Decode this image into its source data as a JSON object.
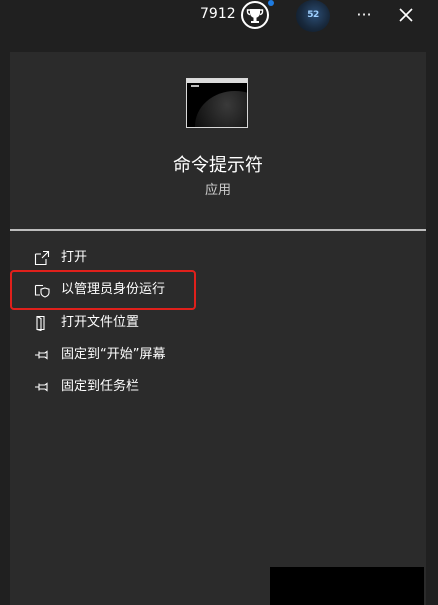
{
  "topbar": {
    "points": "7912",
    "avatar_text": "52",
    "more_label": "···"
  },
  "app": {
    "name": "命令提示符",
    "type": "应用"
  },
  "menu": {
    "items": [
      {
        "label": "打开",
        "icon": "open-icon"
      },
      {
        "label": "以管理员身份运行",
        "icon": "shield-icon",
        "highlighted": true
      },
      {
        "label": "打开文件位置",
        "icon": "file-location-icon"
      },
      {
        "label": "固定到“开始”屏幕",
        "icon": "pin-icon"
      },
      {
        "label": "固定到任务栏",
        "icon": "pin-icon"
      }
    ]
  },
  "colors": {
    "background": "#202020",
    "panel": "#2b2b2b",
    "highlight_border": "#e0201b",
    "notification_dot": "#1e7be0"
  }
}
